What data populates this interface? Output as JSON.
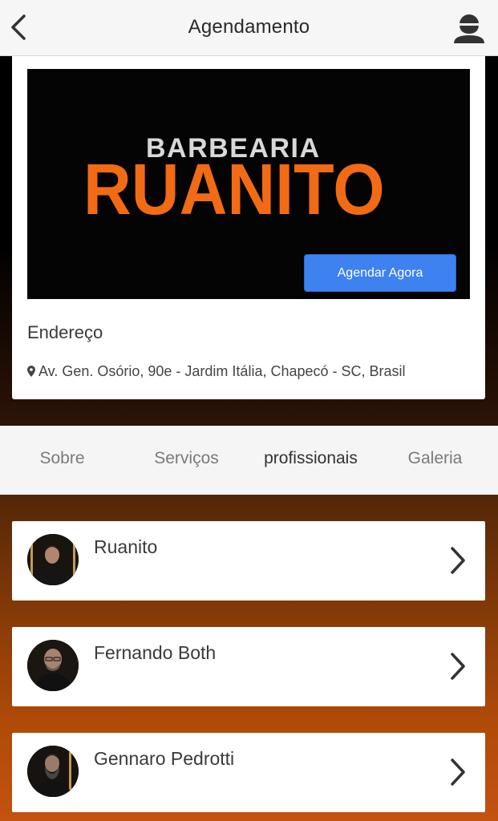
{
  "header": {
    "title": "Agendamento"
  },
  "banner": {
    "brand_top": "BARBEARIA",
    "brand_main": "RUANITO",
    "cta_label": "Agendar Agora"
  },
  "address": {
    "heading": "Endereço",
    "text": "Av. Gen. Osório, 90e - Jardim Itália, Chapecó - SC, Brasil"
  },
  "tabs": [
    {
      "label": "Sobre"
    },
    {
      "label": "Serviços"
    },
    {
      "label": "profissionais",
      "active": true
    },
    {
      "label": "Galeria"
    }
  ],
  "professionals": [
    {
      "name": "Ruanito"
    },
    {
      "name": "Fernando Both"
    },
    {
      "name": "Gennaro Pedrotti"
    }
  ],
  "colors": {
    "accent": "#3d82f0",
    "brand_orange": "#f26b14"
  }
}
